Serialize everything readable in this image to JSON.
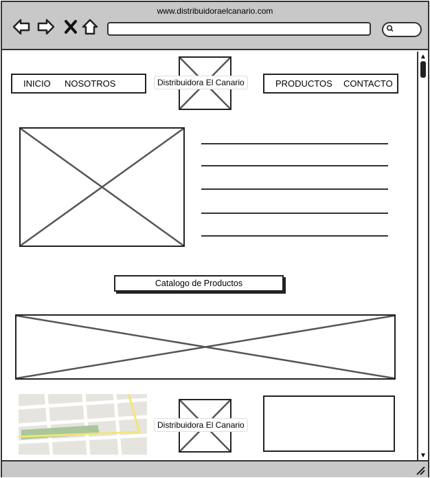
{
  "browser": {
    "url_title": "www.distribuidoraelcanario.com",
    "icons": [
      "back-arrow-icon",
      "forward-arrow-icon",
      "close-x-icon",
      "home-icon",
      "search-icon"
    ]
  },
  "header": {
    "nav_left": [
      "INICIO",
      "NOSOTROS"
    ],
    "brand": "Distribuidora El Canario",
    "nav_right": [
      "PRODUCTOS",
      "CONTACTO"
    ]
  },
  "catalog": {
    "button_label": "Catalogo de Productos"
  },
  "footer": {
    "brand": "Distribuidora El Canario"
  }
}
